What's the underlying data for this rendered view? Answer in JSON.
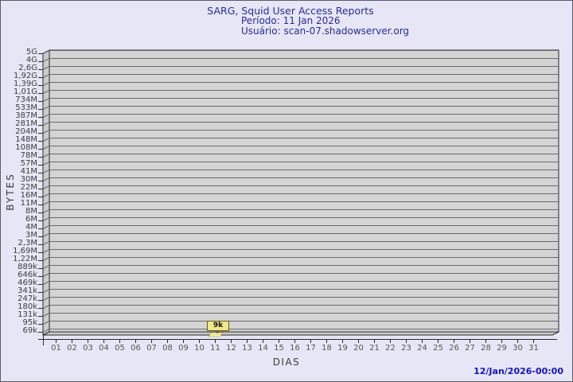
{
  "header": {
    "title": "SARG, Squid User Access Reports",
    "period": "Período: 11 Jan 2026",
    "user": "Usuário: scan-07.shadowserver.org"
  },
  "footer": {
    "timestamp": "12/Jan/2026-00:00"
  },
  "chart_data": {
    "type": "bar",
    "title": "SARG, Squid User Access Reports",
    "xlabel": "DIAS",
    "ylabel": "BYTES",
    "y_tick_labels_top_to_bottom": [
      "5G",
      "4G",
      "2,6G",
      "1,92G",
      "1,39G",
      "1,01G",
      "734M",
      "533M",
      "387M",
      "281M",
      "204M",
      "148M",
      "108M",
      "78M",
      "57M",
      "41M",
      "30M",
      "22M",
      "16M",
      "11M",
      "8M",
      "6M",
      "4M",
      "3M",
      "2,3M",
      "1,69M",
      "1,22M",
      "889k",
      "646k",
      "469k",
      "341k",
      "247k",
      "180k",
      "131k",
      "95k",
      "69k"
    ],
    "y_range_labels": [
      "69k",
      "5G"
    ],
    "categories": [
      "01",
      "02",
      "03",
      "04",
      "05",
      "06",
      "07",
      "08",
      "09",
      "10",
      "11",
      "12",
      "13",
      "14",
      "15",
      "16",
      "17",
      "18",
      "19",
      "20",
      "21",
      "22",
      "23",
      "24",
      "25",
      "26",
      "27",
      "28",
      "29",
      "30",
      "31"
    ],
    "series": [
      {
        "name": "bytes",
        "values": [
          0,
          0,
          0,
          0,
          0,
          0,
          0,
          0,
          0,
          0,
          9000,
          0,
          0,
          0,
          0,
          0,
          0,
          0,
          0,
          0,
          0,
          0,
          0,
          0,
          0,
          0,
          0,
          0,
          0,
          0,
          0
        ]
      }
    ],
    "annotations": [
      {
        "day": "11",
        "label": "9k"
      }
    ],
    "legend": "none",
    "grid": "horizontal",
    "style": "3d-bar"
  },
  "colors": {
    "background": "#e6e6f6",
    "plot_fill": "#d4d4d4",
    "wall_fill": "#cbcbcb",
    "grid_line": "#6a6a6a",
    "frame_line": "#2a2a2a",
    "title_text": "#2a2a94",
    "timestamp_text": "#1414bf",
    "bar_fill": "#f5ec9e",
    "annotation_fill": "#f0e68c"
  }
}
